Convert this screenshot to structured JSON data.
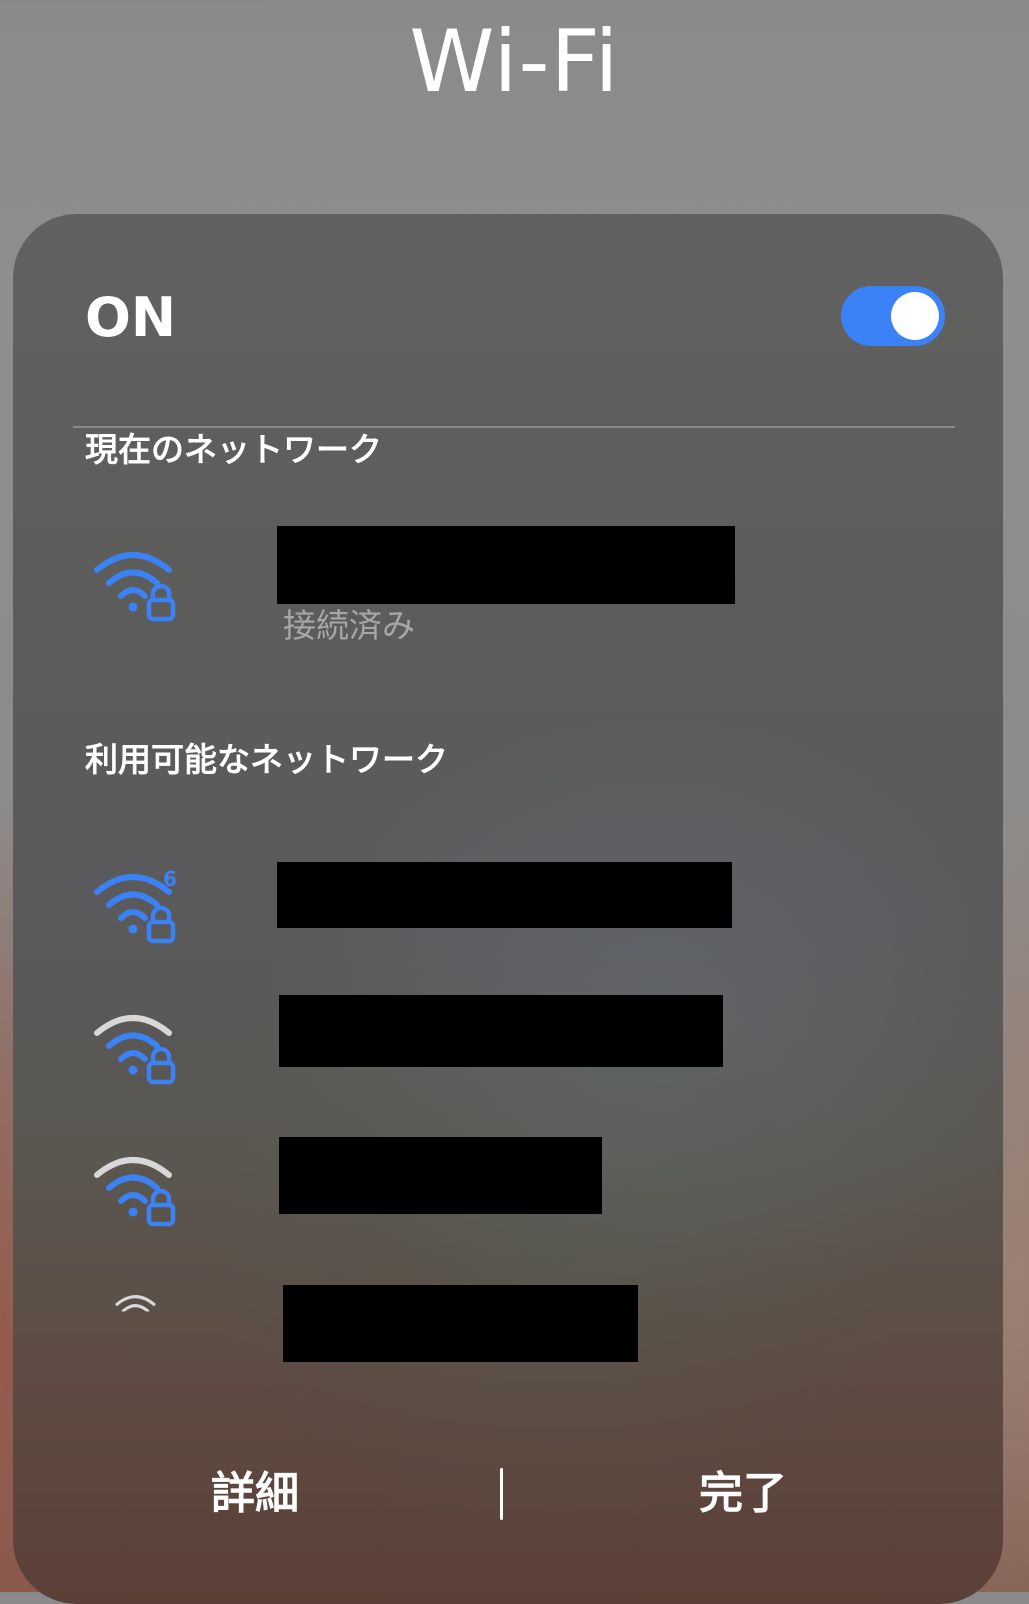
{
  "header": {
    "title": "Wi-Fi"
  },
  "wifi_toggle": {
    "label": "ON",
    "state": "on",
    "accent_color": "#3b82f6"
  },
  "current_network": {
    "section_title": "現在のネットワーク",
    "network": {
      "ssid_redacted": true,
      "status": "接続済み",
      "icon": "wifi-locked-icon"
    }
  },
  "available_networks": {
    "section_title": "利用可能なネットワーク",
    "networks": [
      {
        "ssid_redacted": true,
        "icon": "wifi6-locked-icon",
        "wifi6_badge": "6"
      },
      {
        "ssid_redacted": true,
        "icon": "wifi-locked-icon"
      },
      {
        "ssid_redacted": true,
        "icon": "wifi-locked-icon"
      },
      {
        "ssid_redacted": true,
        "icon": "wifi-locked-icon"
      }
    ]
  },
  "footer": {
    "details_label": "詳細",
    "done_label": "完了"
  },
  "colors": {
    "signal_active": "#3b82f6",
    "signal_inactive": "#d8d8d8",
    "text_primary": "#ffffff",
    "text_secondary": "#a7a7a7"
  }
}
